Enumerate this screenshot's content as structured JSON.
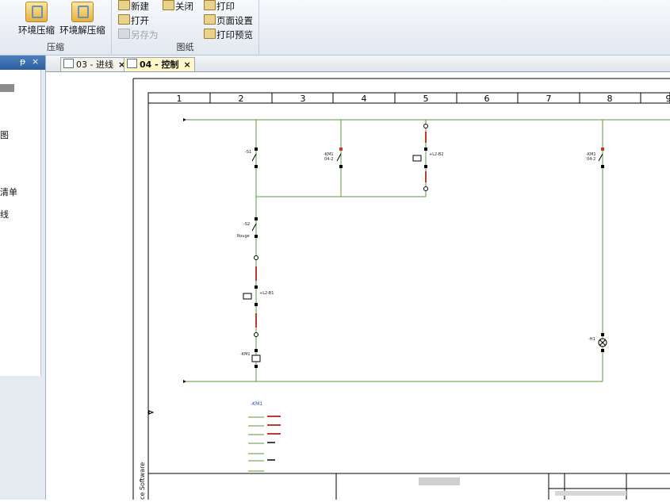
{
  "ribbon": {
    "compress_group": {
      "title": "压缩",
      "env_compress": "环境压缩",
      "env_decompress": "环境解压缩"
    },
    "drawing_group": {
      "title": "图纸",
      "new": "新建",
      "close": "关闭",
      "open": "打开",
      "save_as": "另存为",
      "print": "打印",
      "page_setup": "页面设置",
      "print_preview": "打印预览"
    }
  },
  "left_panel": {
    "pin_glyph": "ᵽ",
    "close_glyph": "×",
    "items": [
      "图",
      "清单",
      "线"
    ]
  },
  "tabs": [
    {
      "label": "03 - 进线",
      "close": "×",
      "active": false
    },
    {
      "label": "04 - 控制",
      "close": "×",
      "active": true
    }
  ],
  "drawing": {
    "columns": [
      "1",
      "2",
      "3",
      "4",
      "5",
      "6",
      "7",
      "8",
      "9"
    ],
    "labels": {
      "s1": "-S1",
      "s2": "-S2",
      "rouge": "Rouge",
      "km1_coil": "-KM1",
      "km1_contact": "-KM1",
      "km1_ref_a": "04-2",
      "km1_contact_b": "-KM1",
      "km1_ref_b": "04-2",
      "h1": "-H1",
      "l2_b2": "+L2-B2",
      "l2_b1": "+L2-B1",
      "xref_title": "-KM1",
      "side_text": "ce Software"
    }
  }
}
